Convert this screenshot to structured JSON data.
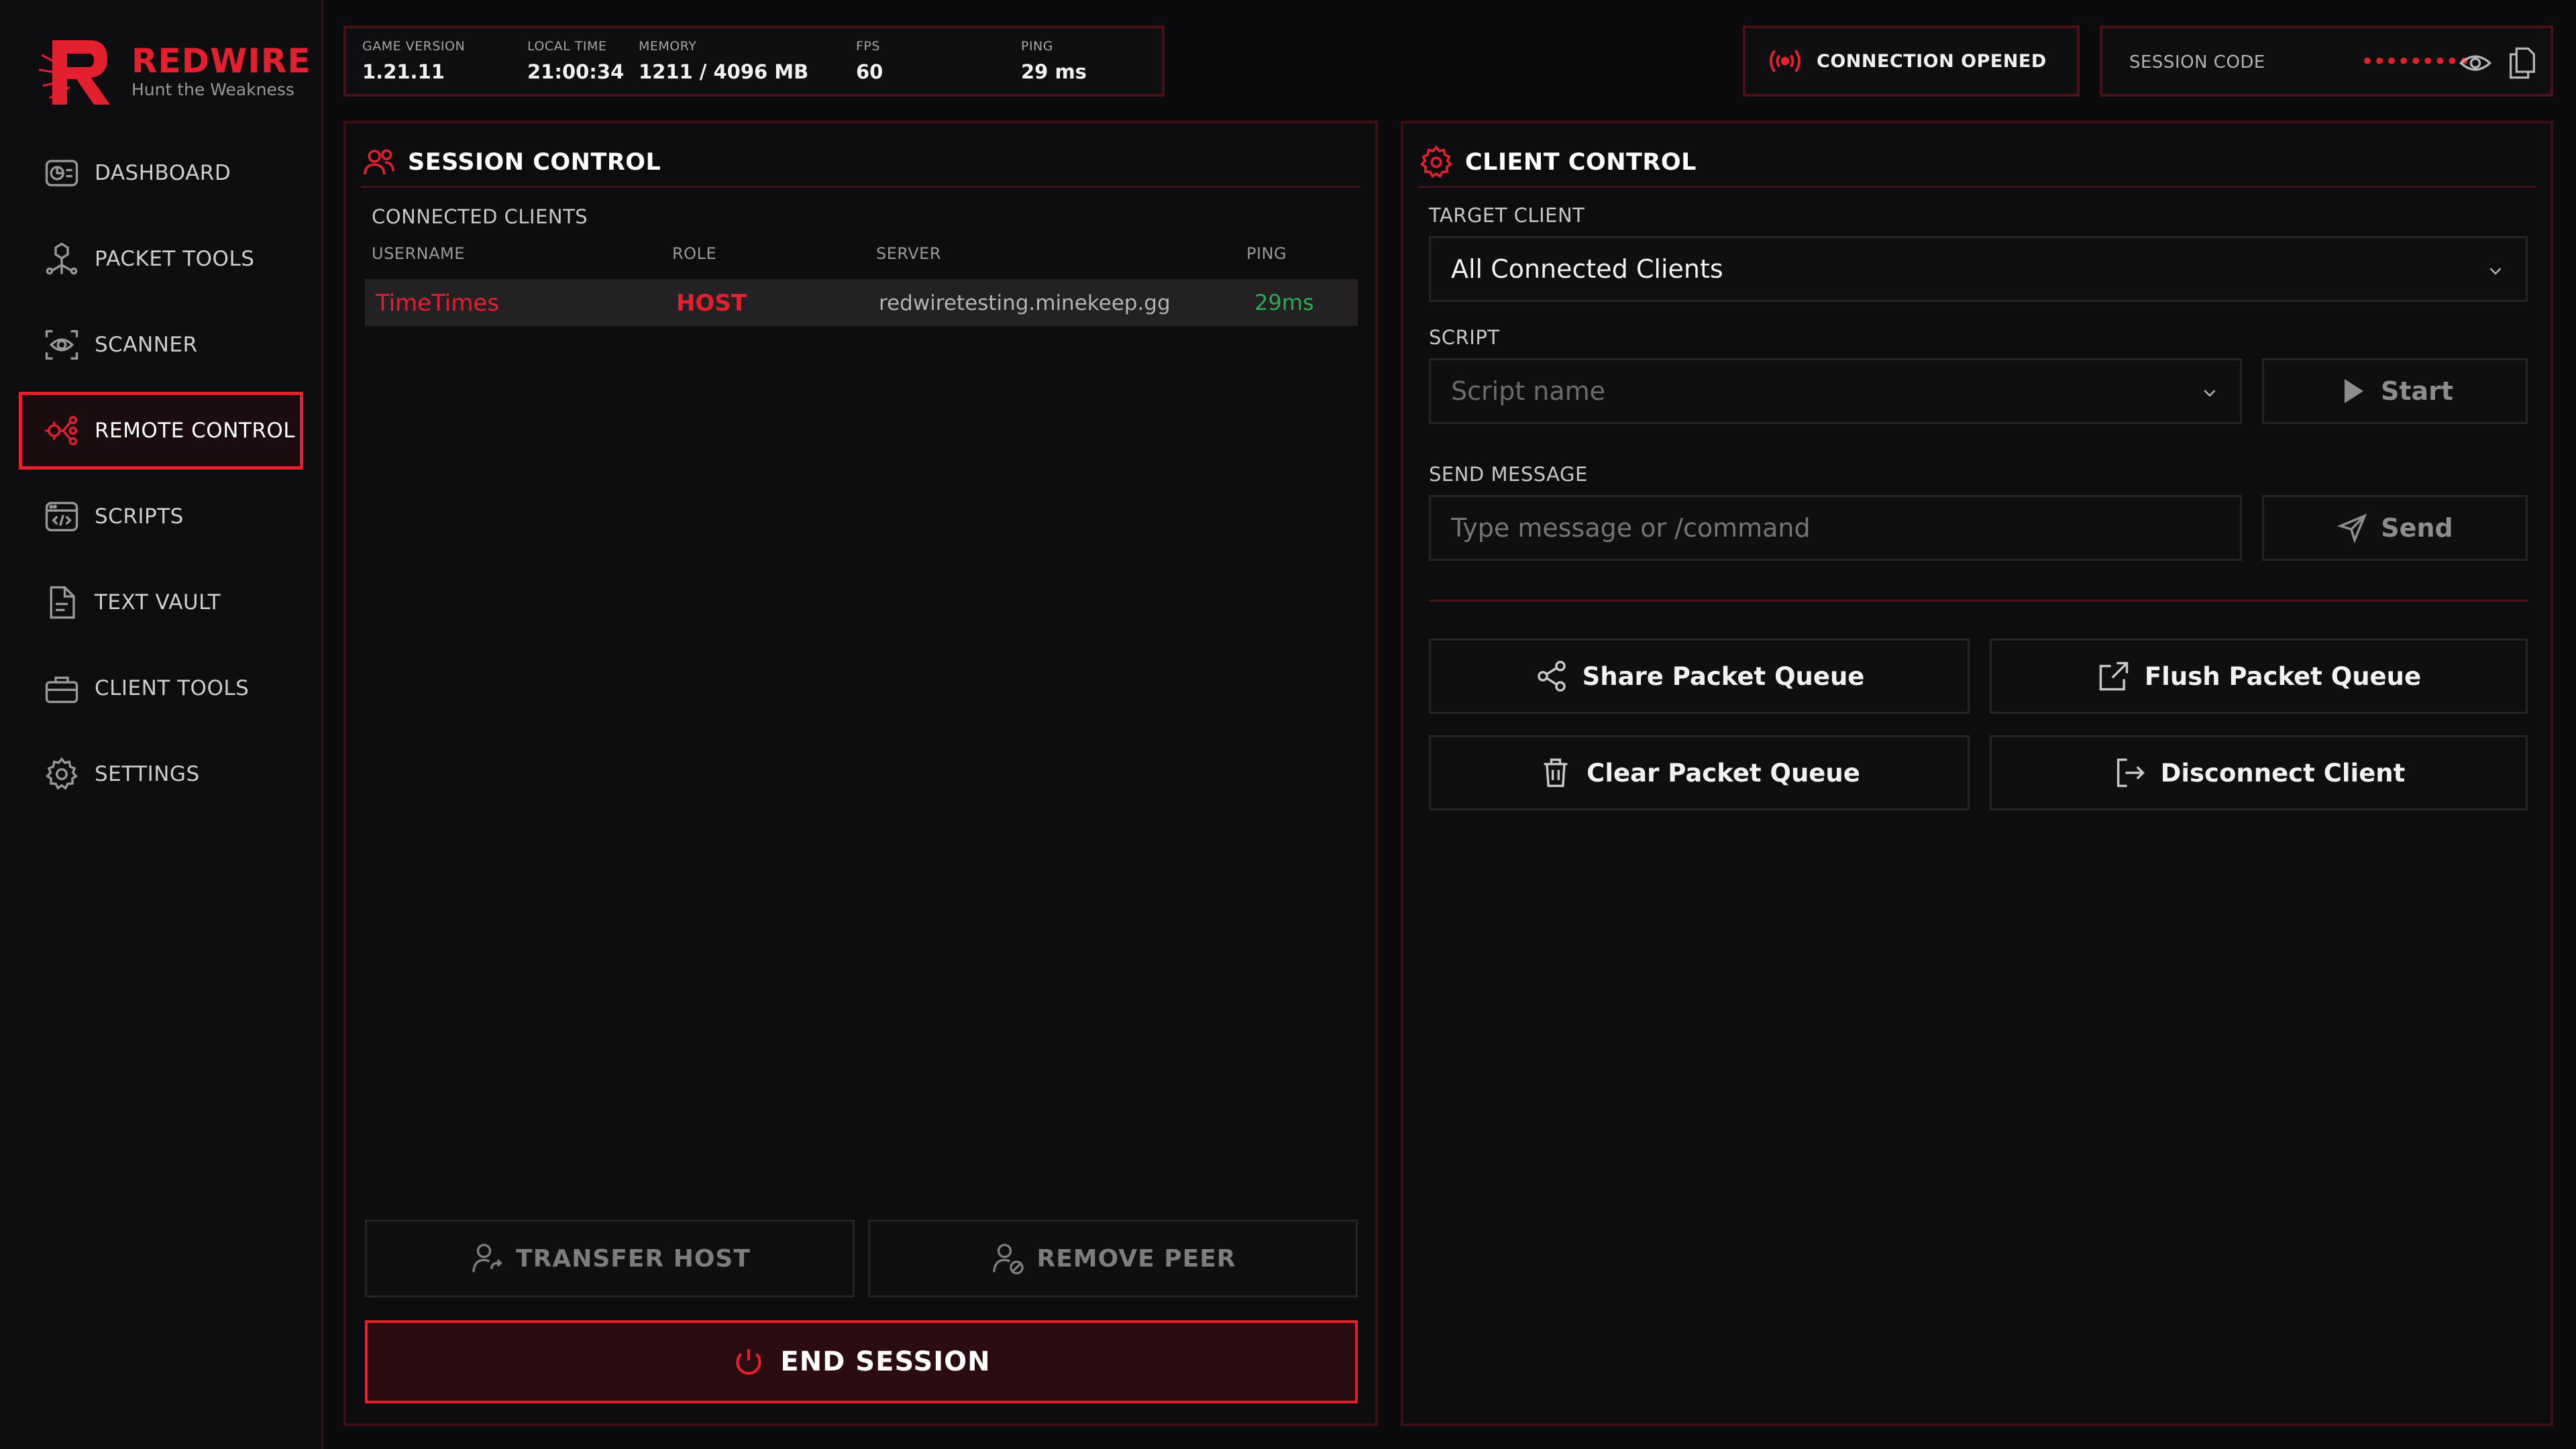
{
  "brand": {
    "name": "REDWIRE",
    "tagline": "Hunt the Weakness"
  },
  "nav": [
    {
      "label": "DASHBOARD",
      "icon": "dashboard-icon"
    },
    {
      "label": "PACKET TOOLS",
      "icon": "network-icon"
    },
    {
      "label": "SCANNER",
      "icon": "eye-scan-icon"
    },
    {
      "label": "REMOTE CONTROL",
      "icon": "remote-control-icon",
      "active": true
    },
    {
      "label": "SCRIPTS",
      "icon": "code-window-icon"
    },
    {
      "label": "TEXT VAULT",
      "icon": "document-icon"
    },
    {
      "label": "CLIENT TOOLS",
      "icon": "toolbox-icon"
    },
    {
      "label": "SETTINGS",
      "icon": "gear-icon"
    }
  ],
  "stats": {
    "game_version": {
      "label": "GAME VERSION",
      "value": "1.21.11"
    },
    "local_time": {
      "label": "LOCAL TIME",
      "value": "21:00:34"
    },
    "memory": {
      "label": "MEMORY",
      "value": "1211 / 4096 MB"
    },
    "fps": {
      "label": "FPS",
      "value": "60"
    },
    "ping": {
      "label": "PING",
      "value": "29 ms"
    }
  },
  "connection": {
    "status": "CONNECTION OPENED"
  },
  "session_code": {
    "label": "SESSION CODE",
    "masked": "•••••••••"
  },
  "session": {
    "title": "SESSION CONTROL",
    "clients_label": "CONNECTED CLIENTS",
    "columns": [
      "USERNAME",
      "ROLE",
      "SERVER",
      "PING"
    ],
    "rows": [
      {
        "username": "TimeTimes",
        "role": "HOST",
        "server": "redwiretesting.minekeep.gg",
        "ping": "29ms"
      }
    ],
    "transfer_host": "TRANSFER HOST",
    "remove_peer": "REMOVE PEER",
    "end_session": "END SESSION"
  },
  "client": {
    "title": "CLIENT CONTROL",
    "target_label": "TARGET CLIENT",
    "target_value": "All Connected Clients",
    "script_label": "SCRIPT",
    "script_placeholder": "Script name",
    "start": "Start",
    "message_label": "SEND MESSAGE",
    "message_placeholder": "Type message or /command",
    "send": "Send",
    "actions": {
      "share": "Share Packet Queue",
      "flush": "Flush Packet Queue",
      "clear": "Clear Packet Queue",
      "disconnect": "Disconnect Client"
    }
  },
  "colors": {
    "accent": "#e5202e",
    "ping_good": "#2fa84f",
    "background": "#0b0a0c"
  }
}
